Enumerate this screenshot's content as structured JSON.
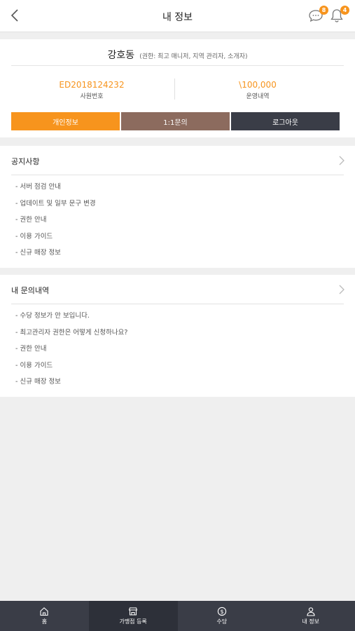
{
  "header": {
    "title": "내 정보",
    "back_icon": "chevron-left-icon",
    "chat_badge": "8",
    "bell_badge": "4"
  },
  "profile": {
    "name": "강호동",
    "role": "(권한: 최고 매니저, 지역 관리자, 소개자)",
    "member_no": "ED2018124232",
    "member_no_label": "사원번호",
    "amount": "\\100,000",
    "amount_label": "운영내역",
    "buttons": [
      "개인정보",
      "1:1문의",
      "로그아웃"
    ]
  },
  "notice": {
    "title": "공지사항",
    "items": [
      "- 서버 점검 안내",
      "- 업데이트 및 일부 문구 변경",
      "- 권한 안내",
      "- 이용 가이드",
      "- 신규 매장 정보"
    ]
  },
  "inquiry": {
    "title": "내 문의내역",
    "items": [
      "- 수당 정보가 안 보입니다.",
      "- 최고관리자 권한은 어떻게 신청하나요?",
      "- 권한 안내",
      "- 이용 가이드",
      "- 신규 매장 정보"
    ]
  },
  "tabbar": {
    "tabs": [
      {
        "label": "홈",
        "icon": "home-icon"
      },
      {
        "label": "가맹점 등록",
        "icon": "store-icon"
      },
      {
        "label": "수당",
        "icon": "dollar-icon"
      },
      {
        "label": "내 정보",
        "icon": "user-icon"
      }
    ]
  },
  "colors": {
    "accent": "#f7941d",
    "brown": "#8c6b5e",
    "dark": "#3a3d47"
  }
}
